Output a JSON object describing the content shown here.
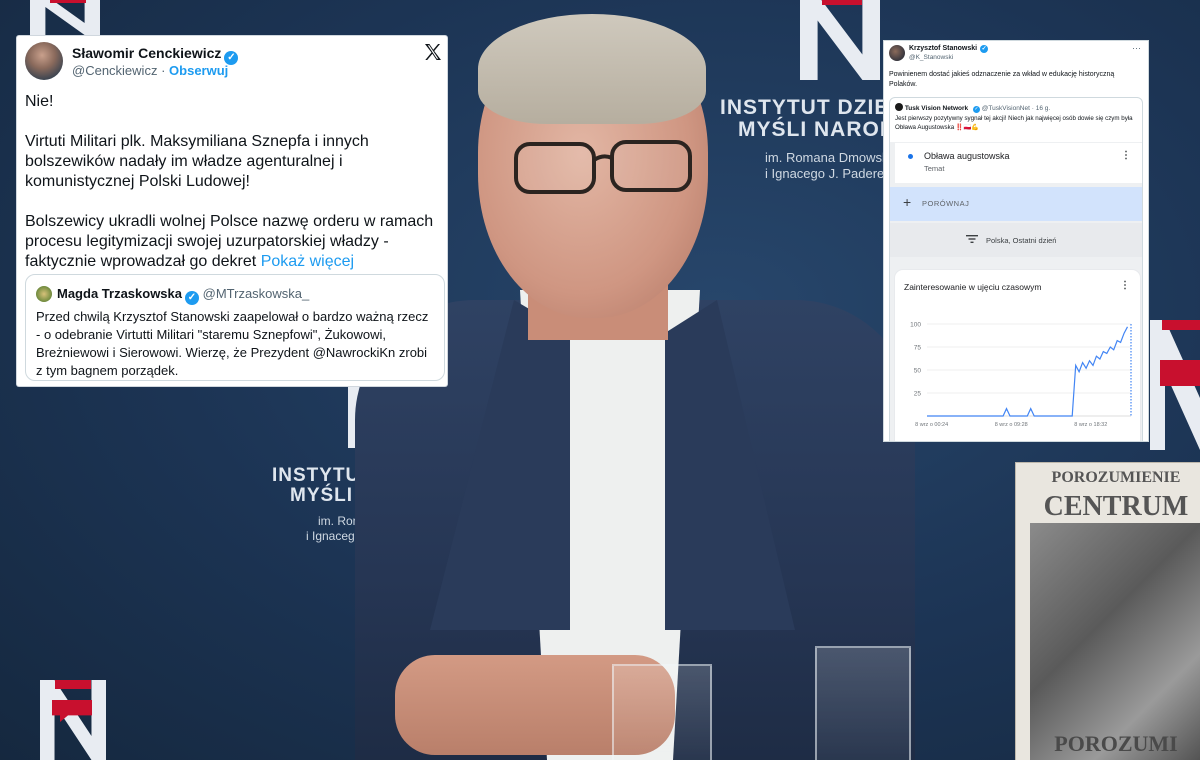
{
  "background": {
    "logo_letter": "N",
    "institute_lines": [
      "INSTYTUT DZIEDZ",
      "MYŚLI NARODO"
    ],
    "institute_sub": [
      "im. Romana Dmowsk",
      "i Ignacego J. Paderews"
    ],
    "institute_lines_2": [
      "INSTYTUT",
      "MYŚLI N"
    ],
    "institute_sub_2": [
      "im. Roma",
      "i Ignacego"
    ],
    "book_title_top": [
      "POROZUMIENIE",
      "CENTRUM"
    ],
    "book_title_bottom": "POROZUMI"
  },
  "tweet_left": {
    "author_name": "Sławomir Cenckiewicz",
    "author_handle": "@Cenckiewicz",
    "separator": "·",
    "follow_label": "Obserwuj",
    "platform_icon": "x-logo-icon",
    "paragraphs": [
      "Nie!",
      "Virtuti Militari plk. Maksymiliana Sznepfa i innych bolszewików nadały im władze agenturalnej i komunistycznej Polski Ludowej!",
      "Bolszewicy ukradli wolnej Polsce nazwę orderu w ramach procesu legitymizacji swojej uzurpatorskiej władzy - faktycznie wprowadzał go dekret"
    ],
    "show_more_label": "Pokaż więcej",
    "quote": {
      "author_name": "Magda Trzaskowska",
      "author_handle": "@MTrzaskowska_",
      "text": "Przed chwilą Krzysztof Stanowski zaapelował o bardzo ważną rzecz - o odebranie Virtutti Militari \"staremu Sznepfowi\", Żukowowi, Breżniewowi i Sierowowi. Wierzę, że Prezydent @NawrockiKn zrobi z tym bagnem porządek."
    }
  },
  "tweet_right": {
    "author_name": "Krzysztof Stanowski",
    "author_handle": "@K_Stanowski",
    "more_icon": "more-horizontal-icon",
    "text": "Powinienem dostać jakieś odznaczenie za wkład w edukację historyczną Polaków.",
    "quote": {
      "author_name": "Tusk Vision Network",
      "author_handle": "@TuskVisionNet",
      "time": "16 g.",
      "text": "Jest pierwszy pozytywny sygnał tej akcji! Niech jak najwięcej osób dowie się czym była Obława Augustowska ‼️🇵🇱💪"
    },
    "trends": {
      "topic_title": "Obława augustowska",
      "topic_sub": "Temat",
      "compare_label": "PORÓWNAJ",
      "filter_label": "Polska, Ostatni dzień",
      "chart_title": "Zainteresowanie w ujęciu czasowym"
    }
  },
  "chart_data": {
    "type": "line",
    "title": "Zainteresowanie w ujęciu czasowym",
    "xlabel": "",
    "ylabel": "",
    "ylim": [
      0,
      100
    ],
    "yticks": [
      100,
      75,
      50,
      25
    ],
    "xtick_labels": [
      "8 wrz o 00:24",
      "8 wrz o 09:28",
      "8 wrz o 18:32"
    ],
    "series": [
      {
        "color": "#4285f4",
        "x": [
          0,
          1,
          2,
          3,
          4,
          5,
          6,
          7,
          8,
          9,
          10,
          11,
          12,
          13,
          14,
          15,
          16,
          17,
          18,
          19,
          20,
          21,
          22,
          23,
          24,
          25,
          26,
          27,
          28,
          29,
          30,
          31,
          32,
          33,
          34,
          35,
          36,
          37,
          38,
          39,
          40,
          41,
          42,
          43,
          44,
          45,
          46,
          47,
          48,
          49,
          50,
          51,
          52,
          53,
          54,
          55,
          56,
          57,
          58,
          59
        ],
        "values": [
          0,
          0,
          0,
          0,
          0,
          0,
          0,
          0,
          0,
          0,
          0,
          0,
          0,
          0,
          0,
          0,
          0,
          0,
          0,
          0,
          0,
          0,
          0,
          8,
          0,
          0,
          0,
          0,
          0,
          0,
          8,
          0,
          0,
          0,
          0,
          0,
          0,
          0,
          0,
          0,
          0,
          0,
          0,
          55,
          48,
          58,
          52,
          60,
          55,
          65,
          62,
          70,
          68,
          75,
          72,
          82,
          80,
          90,
          97,
          100
        ]
      }
    ]
  },
  "colors": {
    "twitter_blue": "#1d9bf0",
    "brand_red": "#c8102e",
    "trend_line": "#4285f4"
  }
}
